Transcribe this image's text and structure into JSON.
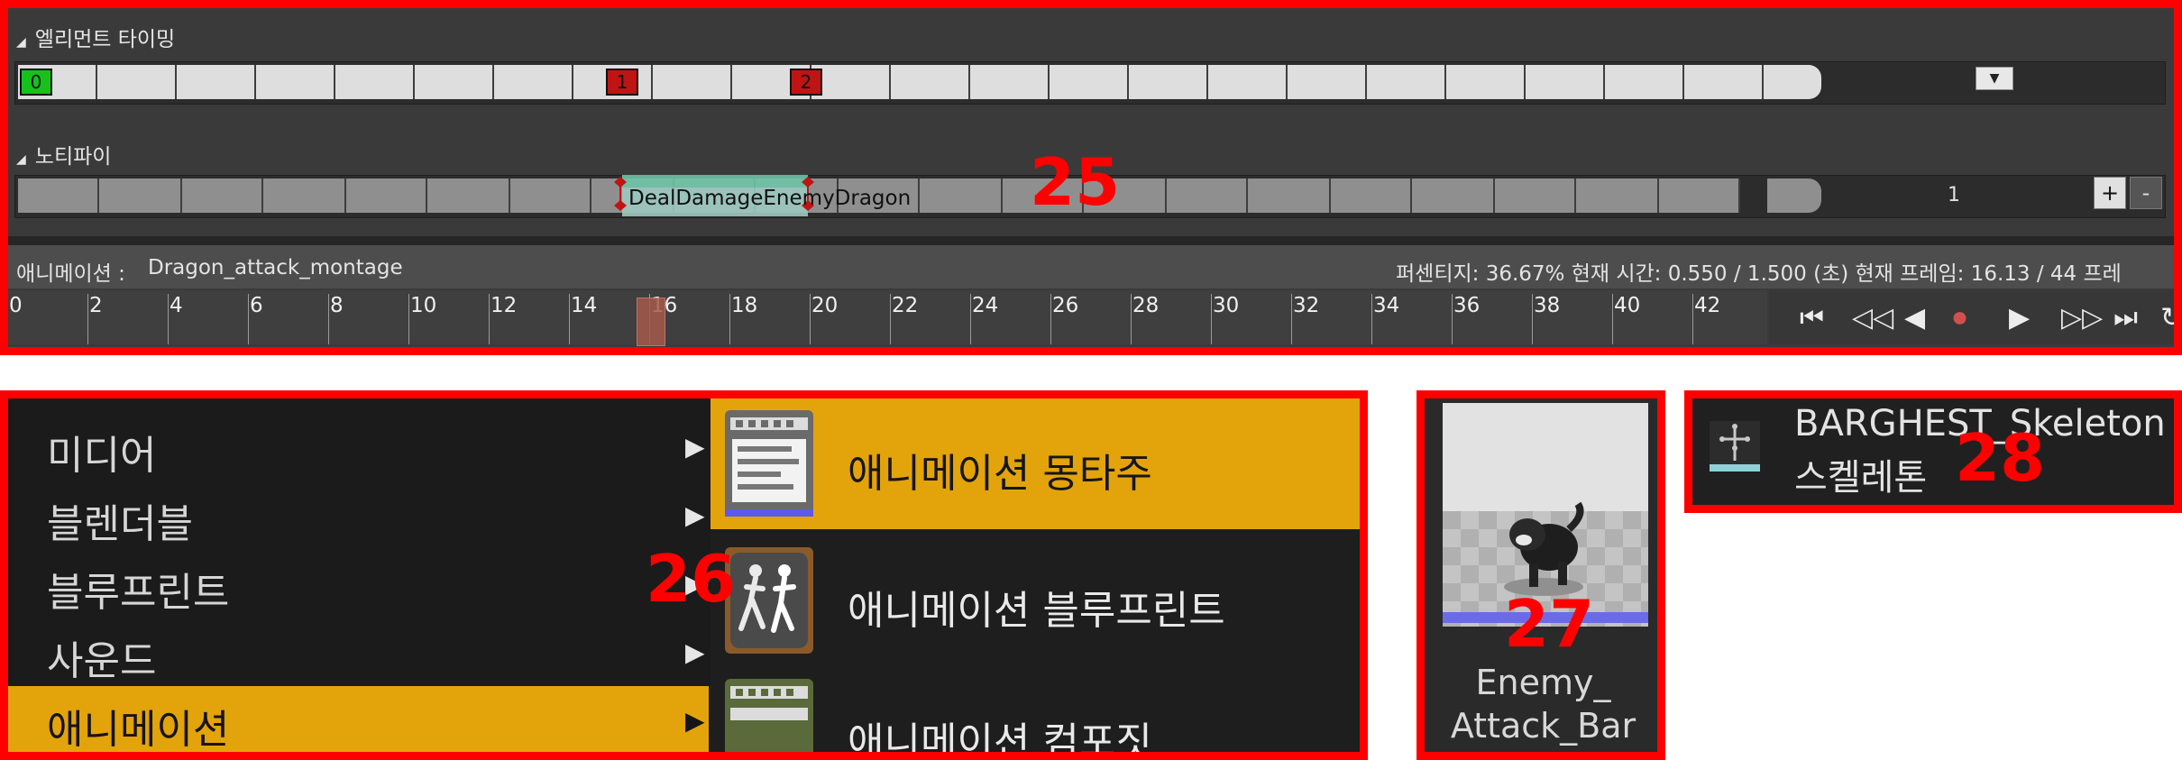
{
  "panel25": {
    "callout": "25",
    "section_timing_title": "엘리먼트 타이밍",
    "section_notify_title": "노티파이",
    "timing_markers": [
      "0",
      "1",
      "2"
    ],
    "dropdown_icon": "chevron-down-icon",
    "notify_name": "DealDamageEnemyDragon",
    "notify_track_number": "1",
    "add_label": "+",
    "remove_label": "-",
    "animation_label": "애니메이션 :",
    "animation_name": "Dragon_attack_montage",
    "status_text": "퍼센티지:  36.67% 현재 시간:  0.550 / 1.500 (초) 현재 프레임:  16.13 / 44 프레",
    "ruler_labels": [
      "0",
      "2",
      "4",
      "6",
      "8",
      "10",
      "12",
      "14",
      "16",
      "18",
      "20",
      "22",
      "24",
      "26",
      "28",
      "30",
      "32",
      "34",
      "36",
      "38",
      "40",
      "42"
    ],
    "transport_buttons": [
      "⏮",
      "◁◁",
      "◀",
      "⏺",
      "▶",
      "▷▷",
      "⏭",
      "↻"
    ],
    "colors": {
      "marker_start": "#17c11c",
      "marker_red": "#c01414",
      "highlight": "#e3a30a"
    }
  },
  "panel26": {
    "callout": "26",
    "menu_items": [
      "미디어",
      "블렌더블",
      "블루프린트",
      "사운드",
      "애니메이션"
    ],
    "submenu_items": [
      "애니메이션 몽타주",
      "애니메이션 블루프린트",
      "애니메이션 컴포짓"
    ]
  },
  "panel27": {
    "callout": "27",
    "asset_name_line1": "Enemy_",
    "asset_name_line2": "Attack_Bar"
  },
  "panel28": {
    "callout": "28",
    "asset_name": "BARGHEST_Skeleton",
    "asset_type": "스켈레톤"
  }
}
